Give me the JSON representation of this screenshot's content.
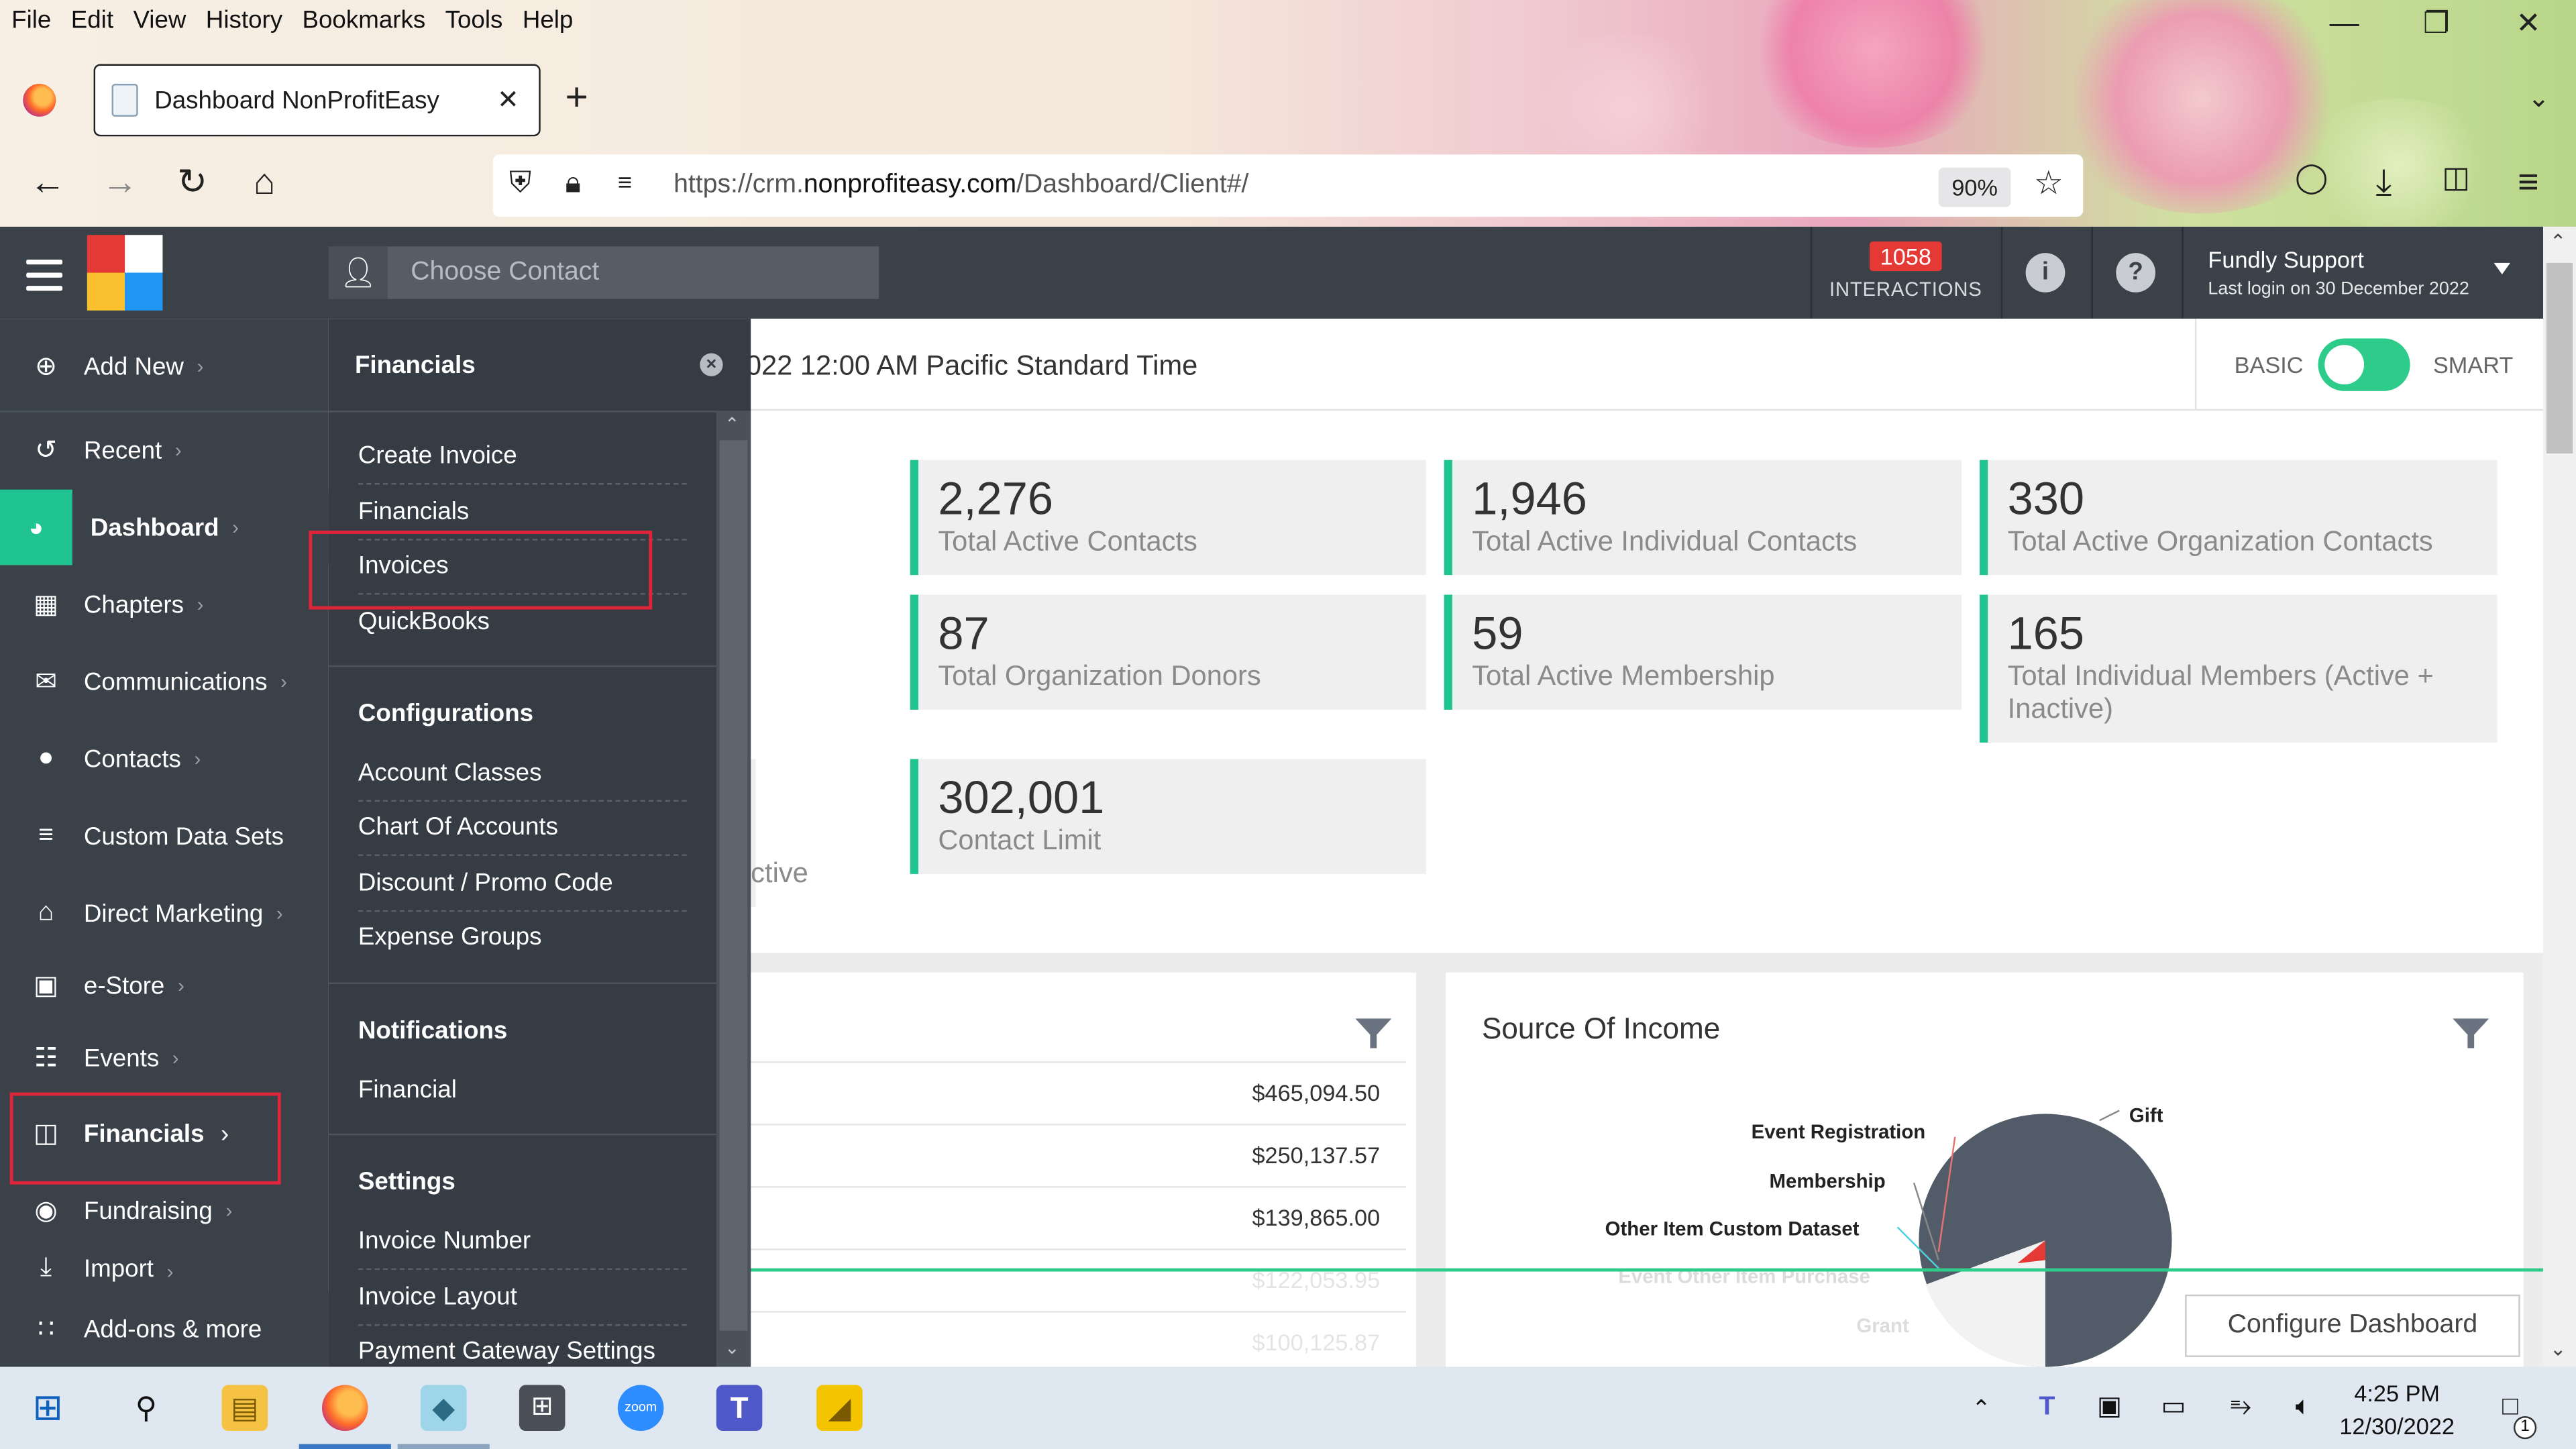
{
  "browser": {
    "menu": [
      "File",
      "Edit",
      "View",
      "History",
      "Bookmarks",
      "Tools",
      "Help"
    ],
    "tab_title": "Dashboard NonProfitEasy",
    "url_prefix": "https://crm.",
    "url_domain": "nonprofiteasy.com",
    "url_path": "/Dashboard/Client#/",
    "zoom": "90%"
  },
  "header": {
    "contact_placeholder": "Choose Contact",
    "interactions_count": "1058",
    "interactions_label": "INTERACTIONS",
    "user_name": "Fundly Support",
    "last_login": "Last login on 30 December 2022"
  },
  "sidebar": {
    "items": [
      {
        "label": "Add New",
        "icon": "plus-circle-icon"
      },
      {
        "label": "Recent",
        "icon": "history-icon"
      },
      {
        "label": "Dashboard",
        "icon": "dashboard-icon"
      },
      {
        "label": "Chapters",
        "icon": "grid-icon"
      },
      {
        "label": "Communications",
        "icon": "envelope-icon"
      },
      {
        "label": "Contacts",
        "icon": "user-icon"
      },
      {
        "label": "Custom Data Sets",
        "icon": "stack-icon"
      },
      {
        "label": "Direct Marketing",
        "icon": "house-icon"
      },
      {
        "label": "e-Store",
        "icon": "cart-icon"
      },
      {
        "label": "Events",
        "icon": "calendar-icon"
      },
      {
        "label": "Financials",
        "icon": "money-icon"
      },
      {
        "label": "Fundraising",
        "icon": "moneybag-icon"
      },
      {
        "label": "Import",
        "icon": "import-icon"
      },
      {
        "label": "Add-ons & more",
        "icon": "apps-icon"
      }
    ]
  },
  "flyout": {
    "title": "Financials",
    "top_links": [
      "Create Invoice",
      "Financials",
      "Invoices",
      "QuickBooks"
    ],
    "sections": [
      {
        "title": "Configurations",
        "links": [
          "Account Classes",
          "Chart Of Accounts",
          "Discount / Promo Code",
          "Expense Groups"
        ]
      },
      {
        "title": "Notifications",
        "links": [
          "Financial"
        ]
      },
      {
        "title": "Settings",
        "links": [
          "Invoice Number",
          "Invoice Layout",
          "Payment Gateway Settings"
        ]
      }
    ]
  },
  "main": {
    "timezone_text": "022 12:00 AM Pacific Standard Time",
    "mode_basic": "BASIC",
    "mode_smart": "SMART",
    "partial_card_text": "s (Active",
    "cards": [
      {
        "value": "2,276",
        "label": "Total Active Contacts"
      },
      {
        "value": "1,946",
        "label": "Total Active Individual Contacts"
      },
      {
        "value": "330",
        "label": "Total Active Organization Contacts"
      },
      {
        "value": "87",
        "label": "Total Organization Donors"
      },
      {
        "value": "59",
        "label": "Total Active Membership"
      },
      {
        "value": "165",
        "label": "Total Individual Members (Active + Inactive)"
      },
      {
        "value": "302,001",
        "label": "Contact Limit"
      }
    ],
    "amounts": [
      "$465,094.50",
      "$250,137.57",
      "$139,865.00",
      "$122,053.95",
      "$100,125.87"
    ],
    "income_title": "Source Of Income",
    "pie_labels": [
      "Gift",
      "Event Registration",
      "Membership",
      "Other Item Custom Dataset",
      "Event Other Item Purchase",
      "Grant"
    ],
    "configure_label": "Configure Dashboard"
  },
  "taskbar": {
    "time": "4:25 PM",
    "date": "12/30/2022",
    "notif_count": "1"
  }
}
